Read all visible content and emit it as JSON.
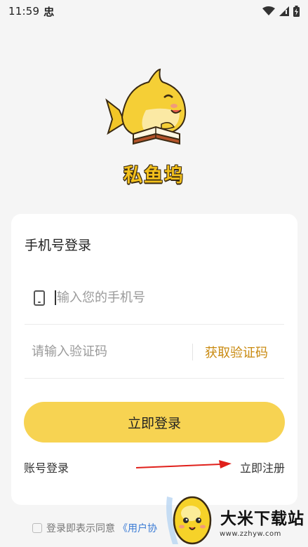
{
  "status_bar": {
    "time": "11:59",
    "sys_glyph": "忠",
    "icons": [
      "wifi-icon",
      "signal-icon",
      "battery-icon"
    ]
  },
  "brand": {
    "name": "私鱼坞",
    "mascot": "yellow-shark-reading-book"
  },
  "login_card": {
    "title": "手机号登录",
    "phone_placeholder": "输入您的手机号",
    "code_placeholder": "请输入验证码",
    "get_code_label": "获取验证码",
    "login_button_label": "立即登录",
    "account_login_label": "账号登录",
    "register_label": "立即注册"
  },
  "agreement": {
    "prefix": "登录即表示同意",
    "link": "《用户协"
  },
  "watermark": {
    "title": "大米下载站",
    "url": "www.zzhyw.com"
  },
  "colors": {
    "accent": "#f7d352",
    "link_orange": "#c98a10",
    "background": "#f5f5f5",
    "arrow": "#e0201b"
  }
}
